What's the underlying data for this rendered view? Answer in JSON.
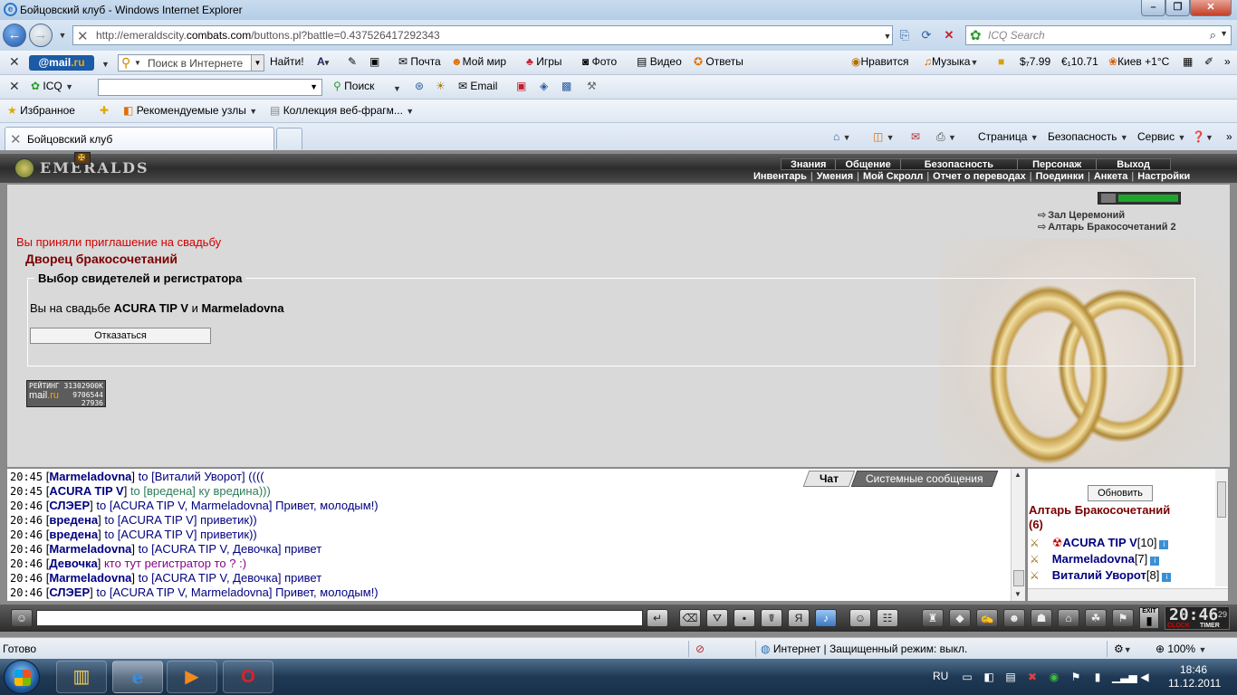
{
  "window": {
    "title": "Бойцовский клуб - Windows Internet Explorer"
  },
  "address": {
    "url_prefix": "http://emeraldscity.",
    "url_domain": "combats.com",
    "url_suffix": "/buttons.pl?battle=0.437526417292343",
    "icq_search_placeholder": "ICQ Search"
  },
  "mailbar": {
    "logo": "@mail",
    "logo_suffix": ".ru",
    "search_placeholder": "Поиск в Интернете",
    "find_button": "Найти!",
    "mail": "Почта",
    "myworld": "Мой мир",
    "games": "Игры",
    "photo": "Фото",
    "video": "Видео",
    "answers": "Ответы",
    "like": "Нравится",
    "music": "Музыка",
    "usd": "$₇7.99",
    "eur": "€₁10.71",
    "weather": "Киев +1°C"
  },
  "icqbar": {
    "icq": "ICQ",
    "search": "Поиск",
    "email": "Email"
  },
  "favbar": {
    "favorites": "Избранное",
    "recommended": "Рекомендуемые узлы",
    "gallery": "Коллекция веб-фрагм..."
  },
  "tabbar": {
    "tab_title": "Бойцовский клуб",
    "page": "Страница",
    "security": "Безопасность",
    "service": "Сервис"
  },
  "game": {
    "logo": "EMERALDS",
    "menu_top": [
      "Знания",
      "Общение",
      "Безопасность",
      "Персонаж",
      "Выход"
    ],
    "menu_bottom": [
      "Инвентарь",
      "Умения",
      "Мой Скролл",
      "Отчет о переводах",
      "Поединки",
      "Анкета",
      "Настройки"
    ],
    "hp_fraction": 1.0,
    "location_links": [
      "Зал Церемоний",
      "Алтарь Бракосочетаний 2"
    ],
    "invite_message": "Вы приняли приглашение на свадьбу",
    "palace_title": "Дворец бракосочетаний",
    "legend": "Выбор свидетелей и регистратора",
    "wedding_prefix": "Вы на свадьбе",
    "groom": "ACURA TIP V",
    "and": "и",
    "bride": "Marmeladovna",
    "refuse_button": "Отказаться",
    "rating": {
      "label": "РЕЙТИНГ",
      "num1": "31302900K",
      "brand": "mail",
      "brand_suffix": ".ru",
      "num2": "9706544",
      "num3": "27936"
    },
    "chat_tabs": {
      "chat": "Чат",
      "system": "Системные сообщения"
    },
    "chat": [
      {
        "time": "20:45",
        "nick": "Marmeladovna",
        "to": "to [Виталий Уворот]",
        "msg": "((((",
        "style": "normal"
      },
      {
        "time": "20:45",
        "nick": "ACURA TIP V",
        "to": "to [вредена]",
        "msg": "ку вредина)))",
        "style": "green"
      },
      {
        "time": "20:46",
        "nick": "СЛЭЕР",
        "to": "to [ACURA TIP V, Marmeladovna]",
        "msg": "Привет, молодым!)",
        "style": "normal"
      },
      {
        "time": "20:46",
        "nick": "вредена",
        "to": "to [ACURA TIP V]",
        "msg": "приветик))",
        "style": "normal"
      },
      {
        "time": "20:46",
        "nick": "вредена",
        "to": "to [ACURA TIP V]",
        "msg": "приветик))",
        "style": "normal"
      },
      {
        "time": "20:46",
        "nick": "Marmeladovna",
        "to": "to [ACURA TIP V, Девочка]",
        "msg": "привет",
        "style": "normal"
      },
      {
        "time": "20:46",
        "nick": "Девочка",
        "to": "кто тут регистратор то ?",
        "msg": ":)",
        "style": "purple"
      },
      {
        "time": "20:46",
        "nick": "Marmeladovna",
        "to": "to [ACURA TIP V, Девочка]",
        "msg": "привет",
        "style": "normal"
      },
      {
        "time": "20:46",
        "nick": "СЛЭЕР",
        "to": "to [ACURA TIP V, Marmeladovna]",
        "msg": "Привет, молодым!)",
        "style": "normal"
      }
    ],
    "side": {
      "refresh": "Обновить",
      "room": "Алтарь Бракосочетаний",
      "count": "(6)",
      "players": [
        {
          "name": "ACURA TIP V",
          "level": "[10]"
        },
        {
          "name": "Marmeladovna",
          "level": "[7]"
        },
        {
          "name": "Виталий Уворот",
          "level": "[8]"
        }
      ]
    },
    "clock": {
      "time": "20:46",
      "sec": "29",
      "clock_label": "CLOCK",
      "timer_label": "TIMER",
      "exit": "EXIT"
    }
  },
  "status": {
    "ready": "Готово",
    "zone": "Интернет | Защищенный режим: выкл.",
    "zoom": "100%"
  },
  "taskbar": {
    "lang": "RU",
    "time": "18:46",
    "date": "11.12.2011"
  }
}
